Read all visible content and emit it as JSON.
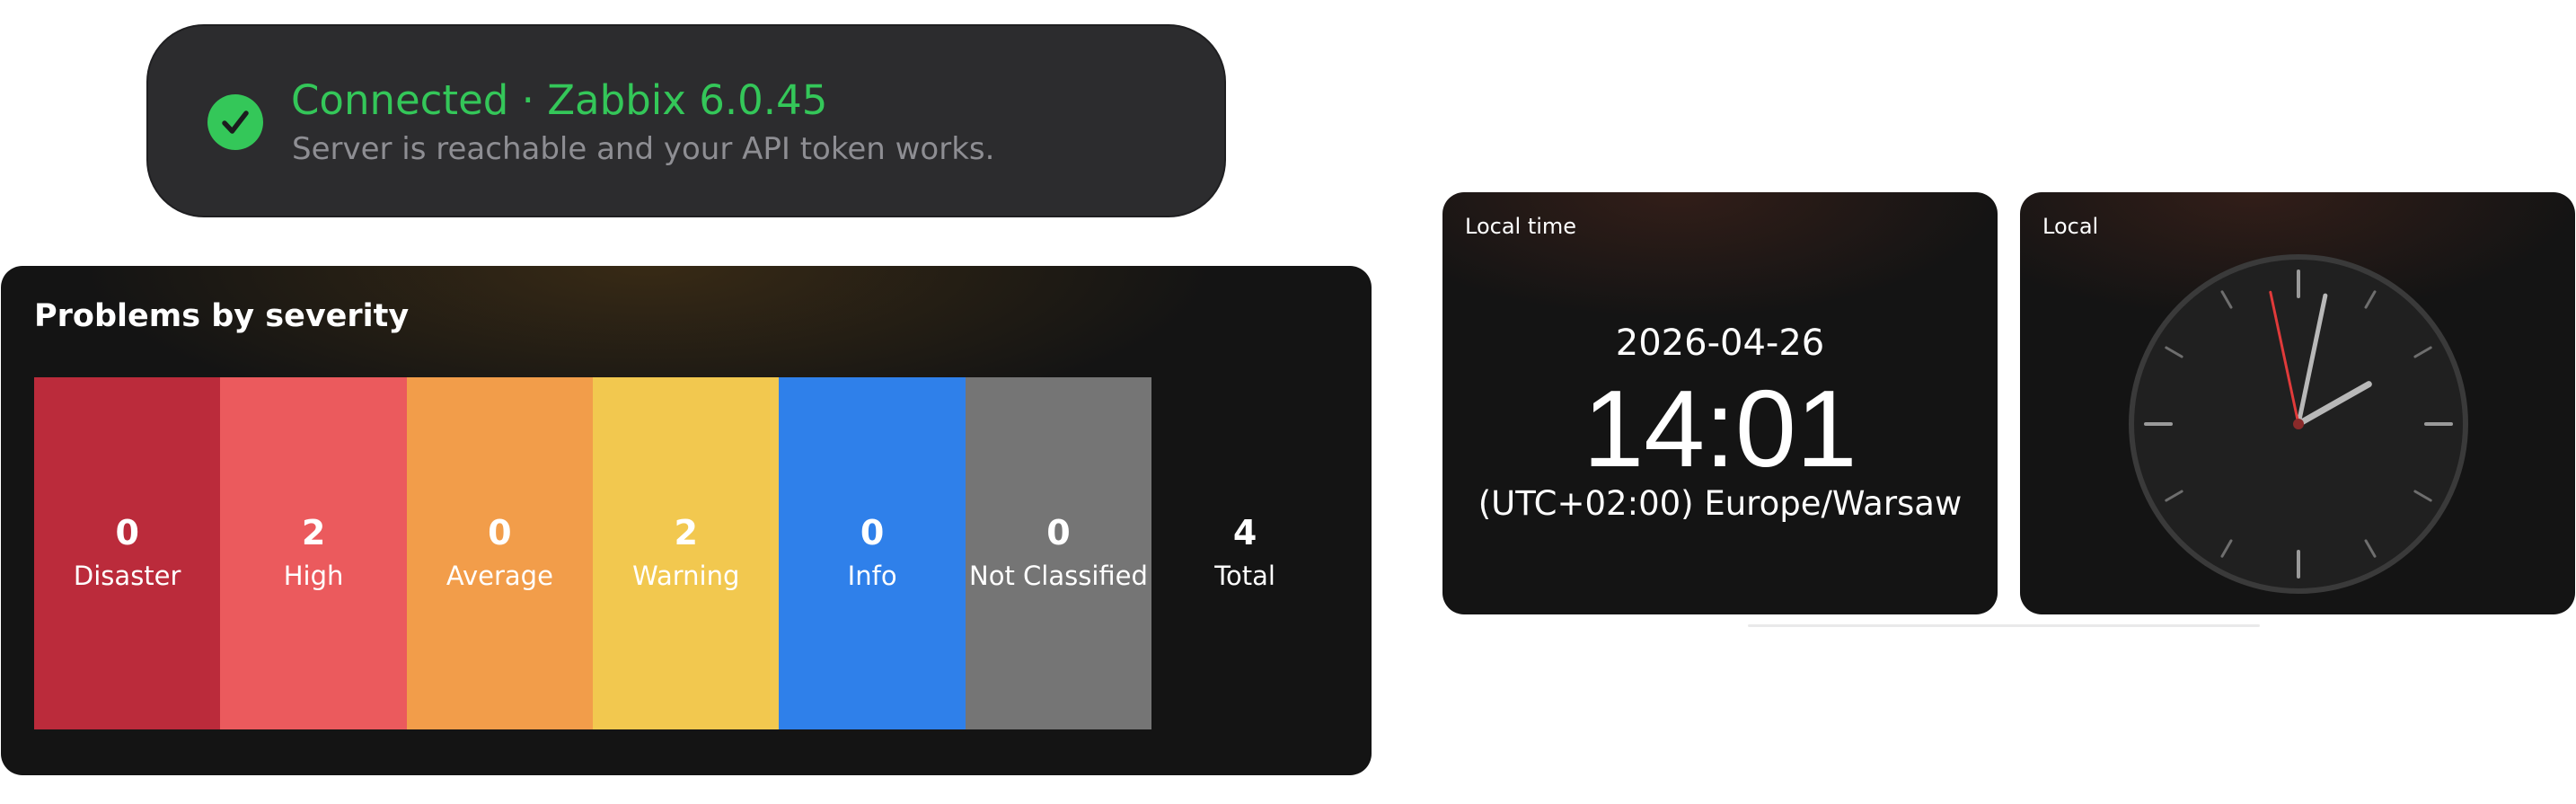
{
  "banner": {
    "title": "Connected · Zabbix 6.0.45",
    "subtitle": "Server is reachable and your API token works.",
    "icon": "check-circle-icon",
    "accent_color": "#34c759"
  },
  "problems": {
    "title": "Problems by severity",
    "severities": [
      {
        "count": "0",
        "label": "Disaster",
        "color": "#bb2b3b"
      },
      {
        "count": "2",
        "label": "High",
        "color": "#eb5a5d"
      },
      {
        "count": "0",
        "label": "Average",
        "color": "#f29d4a"
      },
      {
        "count": "2",
        "label": "Warning",
        "color": "#f2c84f"
      },
      {
        "count": "0",
        "label": "Info",
        "color": "#2f80ea"
      },
      {
        "count": "0",
        "label": "Not Classified",
        "color": "#757575"
      }
    ],
    "total": {
      "count": "4",
      "label": "Total"
    }
  },
  "local_time": {
    "title": "Local time",
    "date": "2026-04-26",
    "time": "14:01",
    "zone": "(UTC+02:00) Europe/Warsaw"
  },
  "analog_clock": {
    "title": "Local",
    "hour": 14,
    "minute": 1,
    "second": 58,
    "second_hand_color": "#e03a3a"
  }
}
